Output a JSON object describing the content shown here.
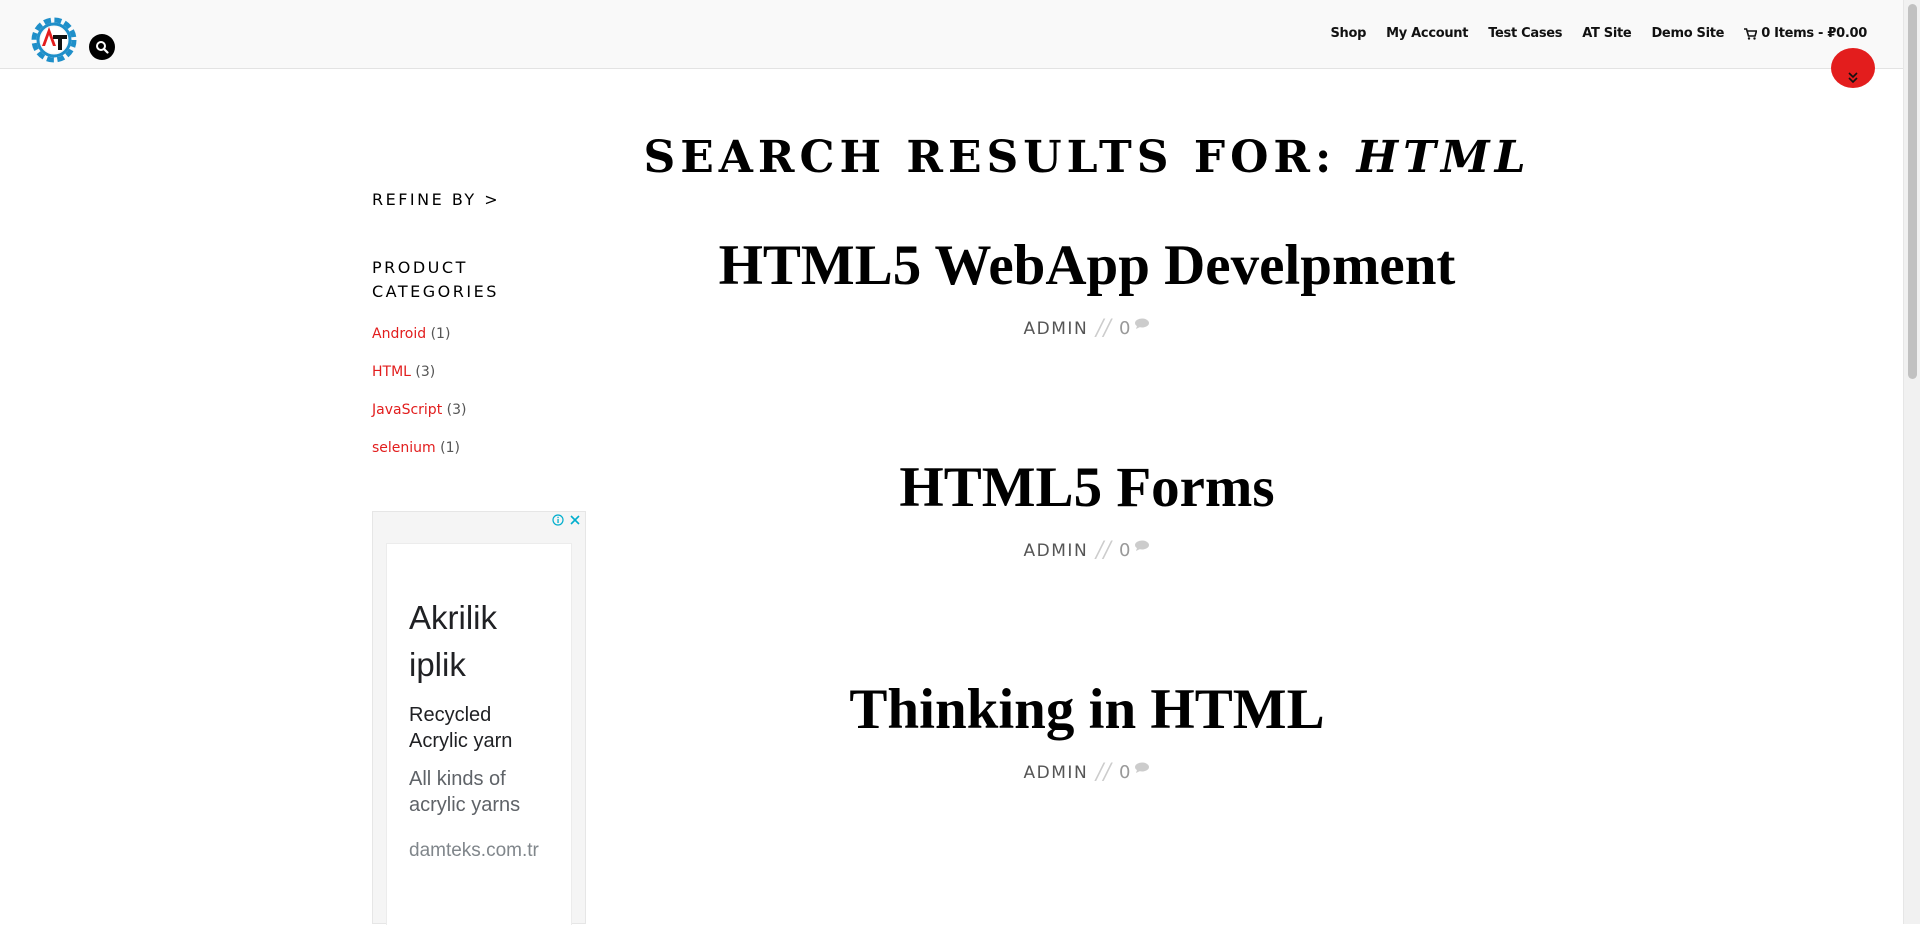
{
  "header": {
    "nav": [
      "Shop",
      "My Account",
      "Test Cases",
      "AT Site",
      "Demo Site"
    ],
    "cart_label": "0 Items - ₽0.00"
  },
  "colors": {
    "accent": "#e21d1d",
    "header_bg": "#f9f9f9",
    "logo_blue": "#1f8fc9",
    "logo_red": "#e31d1d"
  },
  "page": {
    "title_prefix": "SEARCH RESULTS FOR:",
    "query": "HTML"
  },
  "sidebar": {
    "refine_label": "REFINE BY >",
    "categories_title": "PRODUCT CATEGORIES",
    "categories": [
      {
        "name": "Android",
        "count": "(1)"
      },
      {
        "name": "HTML",
        "count": "(3)"
      },
      {
        "name": "JavaScript",
        "count": "(3)"
      },
      {
        "name": "selenium",
        "count": "(1)"
      }
    ]
  },
  "ad": {
    "headline": "Akrilik iplik",
    "subheadline": "Recycled Acrylic yarn",
    "description": "All kinds of acrylic yarns",
    "url": "damteks.com.tr"
  },
  "posts": [
    {
      "title": "HTML5 WebApp Develpment",
      "author": "ADMIN",
      "comments": "0"
    },
    {
      "title": "HTML5 Forms",
      "author": "ADMIN",
      "comments": "0"
    },
    {
      "title": "Thinking in HTML",
      "author": "ADMIN",
      "comments": "0"
    }
  ]
}
